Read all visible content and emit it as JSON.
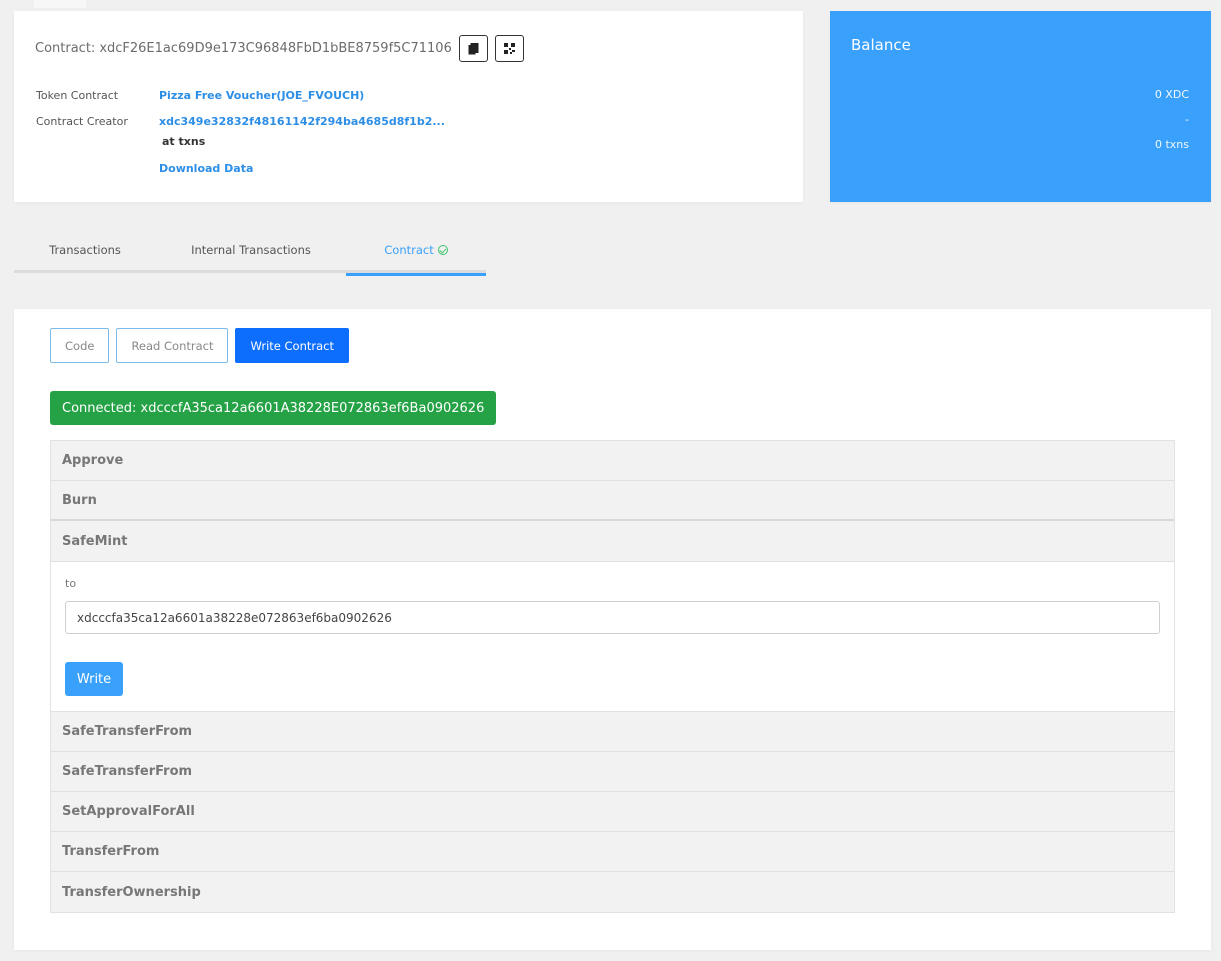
{
  "contract": {
    "label": "Contract:",
    "address": "xdcF26E1ac69D9e173C96848FbD1bBE8759f5C71106",
    "token_contract_key": "Token Contract",
    "token_contract_value": "Pizza Free Voucher(JOE_FVOUCH)",
    "creator_key": "Contract Creator",
    "creator_value": "xdc349e32832f48161142f294ba4685d8f1b2...",
    "at_txns": "at txns",
    "download": "Download Data"
  },
  "balance": {
    "title": "Balance",
    "amount": "0 XDC",
    "value": "-",
    "txns": "0 txns",
    "color": "#39a0fb"
  },
  "tabs": [
    {
      "label": "Transactions"
    },
    {
      "label": "Internal Transactions"
    },
    {
      "label": "Contract"
    }
  ],
  "segments": {
    "code": "Code",
    "read": "Read Contract",
    "write": "Write Contract"
  },
  "connected": {
    "text": "Connected: xdcccfA35ca12a6601A38228E072863ef6Ba0902626",
    "color": "#25a245"
  },
  "functions": {
    "approve": "Approve",
    "burn": "Burn",
    "safemint": "SafeMint",
    "safemint_param_label": "to",
    "safemint_param_value": "xdcccfa35ca12a6601a38228e072863ef6ba0902626",
    "write_label": "Write",
    "safe_transfer_1": "SafeTransferFrom",
    "safe_transfer_2": "SafeTransferFrom",
    "set_approval": "SetApprovalForAll",
    "transfer_from": "TransferFrom",
    "transfer_ownership": "TransferOwnership"
  }
}
